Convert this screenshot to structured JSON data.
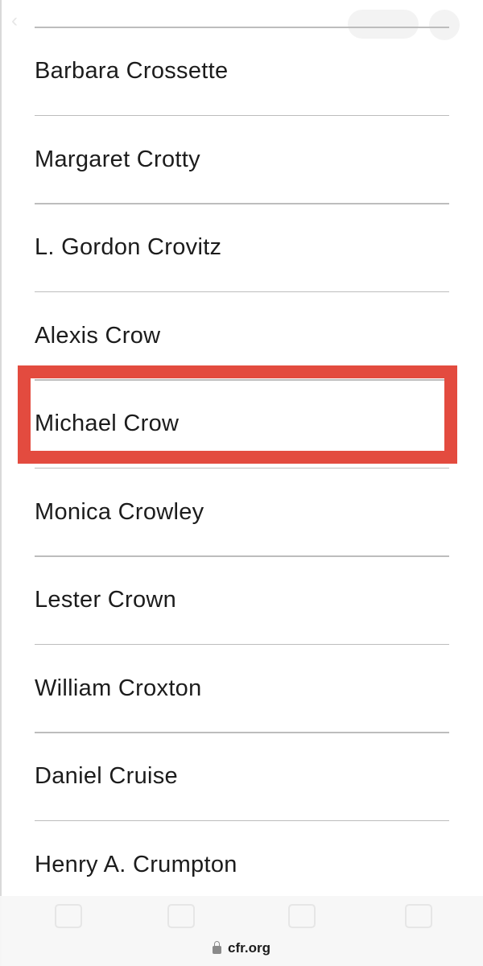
{
  "toolbar": {
    "back_icon": "chevron-left-icon",
    "menu_icon": "more-icon"
  },
  "people": [
    "Barbara Crossette",
    "Margaret Crotty",
    "L. Gordon Crovitz",
    "Alexis Crow",
    "Michael Crow",
    "Monica Crowley",
    "Lester Crown",
    "William Croxton",
    "Daniel Cruise",
    "Henry A. Crumpton"
  ],
  "highlighted_index": 4,
  "highlight_color": "#e34b3f",
  "tab_bar": {
    "tabs": [
      "tab-1",
      "tab-2",
      "tab-3",
      "tab-4"
    ]
  },
  "address_bar": {
    "url": "cfr.org",
    "icon": "lock-icon"
  }
}
